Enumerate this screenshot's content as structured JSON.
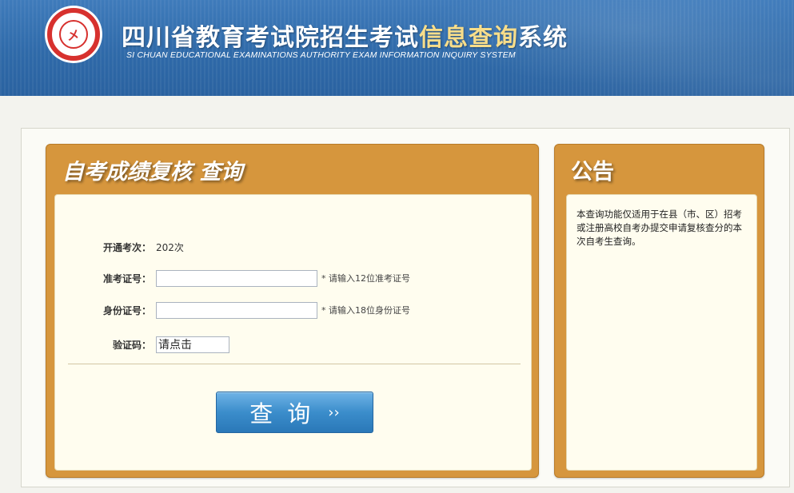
{
  "header": {
    "logo_text": "四川省教育考试院",
    "logo_glyph": "㐅",
    "title_cn_part1": "四川省教育考试院招生考试",
    "title_cn_highlight": "信息查询",
    "title_cn_part2": "系统",
    "title_en": "SI CHUAN EDUCATIONAL EXAMINATIONS AUTHORITY EXAM INFORMATION INQUIRY SYSTEM"
  },
  "query_panel": {
    "title": "自考成绩复核  查询",
    "session": {
      "label": "开通考次：",
      "value": "202次"
    },
    "ticket": {
      "label": "准考证号：",
      "value": "",
      "hint": "* 请输入12位准考证号"
    },
    "idcard": {
      "label": "身份证号：",
      "value": "",
      "hint": "* 请输入18位身份证号"
    },
    "captcha": {
      "label": "验证码：",
      "value": "请点击"
    },
    "submit_label": "查询",
    "submit_arrow": "››"
  },
  "notice_panel": {
    "title": "公告",
    "text": "本查询功能仅适用于在县（市、区）招考或注册高校自考办提交申请复核查分的本次自考生查询。"
  },
  "colors": {
    "header_blue": "#2f6aa9",
    "panel_orange": "#d6963d",
    "button_blue": "#3b8dcb",
    "highlight_yellow": "#f7dd8a"
  }
}
